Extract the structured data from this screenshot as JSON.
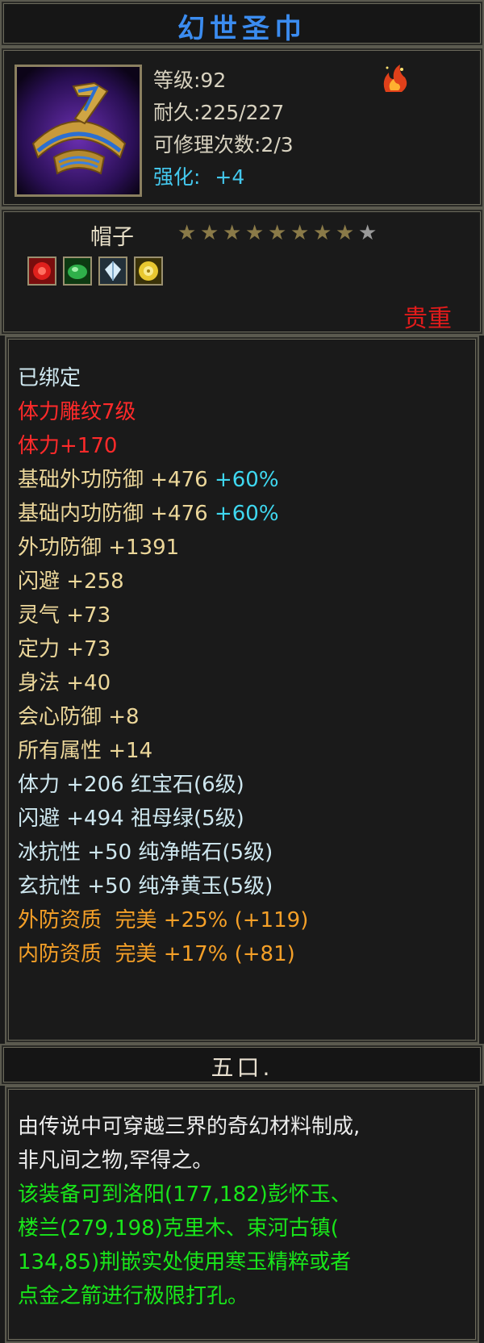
{
  "item": {
    "name": "幻世圣巾",
    "level_label": "等级:92",
    "durability_label": "耐久:225/227",
    "repair_label": "可修理次数:2/3",
    "enhance_prefix": "强化:",
    "enhance_value": "+4",
    "type": "帽子",
    "stars": {
      "filled": 8,
      "total": 9
    },
    "rarity": "贵重",
    "icons": {
      "item_icon": "hat-icon",
      "fire_icon": "fire-icon",
      "gems": [
        "ruby-gem-icon",
        "emerald-gem-icon",
        "crystal-gem-icon",
        "jade-gem-icon"
      ]
    }
  },
  "attributes": {
    "bound": "已绑定",
    "engrave": "体力雕纹7级",
    "engrave_bonus": "体力+170",
    "base_outer_def": {
      "label": "基础外功防御 +476",
      "bonus": "+60%"
    },
    "base_inner_def": {
      "label": "基础内功防御 +476",
      "bonus": "+60%"
    },
    "outer_def": "外功防御 +1391",
    "dodge": "闪避 +258",
    "spirit": "灵气 +73",
    "focus": "定力 +73",
    "agility": "身法 +40",
    "crit_def": "会心防御 +8",
    "all_attr": "所有属性 +14",
    "gem1": "体力 +206 红宝石(6级)",
    "gem2": "闪避 +494 祖母绿(5级)",
    "gem3": "冰抗性 +50 纯净皓石(5级)",
    "gem4": "玄抗性 +50 纯净黄玉(5级)",
    "quality1": "外防资质  完美 +25% (+119)",
    "quality2": "内防资质  完美 +17% (+81)"
  },
  "owner": "五口.",
  "description": {
    "line1": "由传说中可穿越三界的奇幻材料制成,",
    "line2": "非凡间之物,罕得之。",
    "line3": "该装备可到洛阳(177,182)彭怀玉、",
    "line4": "楼兰(279,198)克里木、束河古镇(",
    "line5": "134,85)荆嵌实处使用寒玉精粹或者",
    "line6": "点金之箭进行极限打孔。"
  },
  "colors": {
    "title": "#3b8cf0",
    "stat_text": "#d8d2c0",
    "enhance": "#44c8ee",
    "attr_gold": "#ecd79a",
    "red": "#ff2a2a",
    "cyan": "#3fd8f0",
    "orange": "#f5a028",
    "green": "#19e61a",
    "rarity": "#e21b1b"
  }
}
